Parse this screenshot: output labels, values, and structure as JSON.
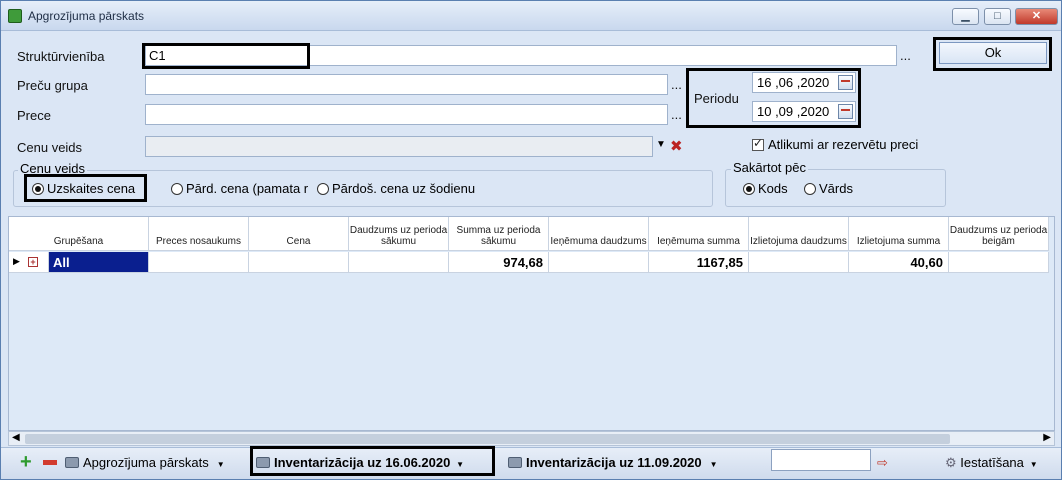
{
  "window": {
    "title": "Apgrozījuma pārskats"
  },
  "form": {
    "struktur_label": "Struktūrvienība",
    "struktur_value": "C1",
    "precu_grupa_label": "Preču grupa",
    "prece_label": "Prece",
    "cenu_veids_label": "Cenu veids",
    "dots": "...",
    "ok_label": "Ok",
    "periodu_label": "Periodu",
    "date_from": "16 ,06 ,2020",
    "date_to": "10 ,09 ,2020",
    "atlikumi_label": "Atlikumi ar rezervētu preci",
    "cenu_group_title": "Cenu veids",
    "radio_uzskaites": "Uzskaites cena",
    "radio_pard": "Pārd. cena (pamata r",
    "radio_pardos": "Pārdoš. cena uz šodienu",
    "sakartot_title": "Sakārtot pēc",
    "radio_kods": "Kods",
    "radio_vards": "Vārds"
  },
  "grid": {
    "headers": [
      "Grupēšana",
      "Preces nosaukums",
      "Cena",
      "Daudzums uz perioda sākumu",
      "Summa uz perioda sākumu",
      "Ieņēmuma daudzums",
      "Ieņēmuma summa",
      "Izlietojuma daudzums",
      "Izlietojuma summa",
      "Daudzums uz perioda beigām"
    ],
    "row": {
      "group": "All",
      "summa_sakums": "974,68",
      "ienemuma_summa": "1167,85",
      "izlietojuma_summa": "40,60"
    }
  },
  "toolbar": {
    "report1": "Apgrozījuma pārskats",
    "report2": "Inventarizācija uz 16.06.2020",
    "report3": "Inventarizācija uz 11.09.2020",
    "settings": "Iestatīšana"
  }
}
